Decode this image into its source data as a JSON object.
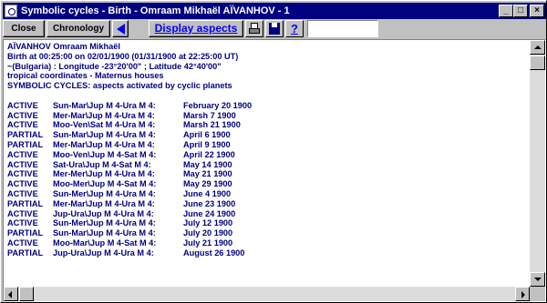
{
  "window": {
    "title": "Symbolic cycles - Birth - Omraam Mikhaël AÏVANHOV - 1",
    "controls": {
      "minimize": "_",
      "maximize": "□",
      "close": "×"
    }
  },
  "toolbar": {
    "close_label": "Close",
    "chronology_label": "Chronology",
    "display_aspects_label": "Display aspects",
    "help_label": "?",
    "search_value": ""
  },
  "colors": {
    "text": "#000080",
    "titlebar": "#000080",
    "link": "#0000ff",
    "face": "#c0c0c0"
  },
  "icons": {
    "back": "left-arrow-icon",
    "print": "printer-icon",
    "save": "floppy-disk-icon",
    "help": "help-icon"
  },
  "report": {
    "header": [
      "AÏVANHOV Omraam Mikhaël",
      "Birth at 00:25:00 on 02/01/1900 (01/31/1900 at 22:25:00 UT)",
      "~(Bulgaria) : Longitude -23°20'00\" ; Latitude 42°40'00\"",
      "tropical coordinates - Maternus houses",
      "SYMBOLIC CYCLES: aspects activated by cyclic planets"
    ],
    "rows": [
      {
        "status": "ACTIVE",
        "aspect": "Sun-Mar\\Jup M 4-Ura M 4:",
        "date": "February 20 1900"
      },
      {
        "status": "ACTIVE",
        "aspect": "Mer-Mar\\Jup M 4-Ura M 4:",
        "date": "Marsh 7 1900"
      },
      {
        "status": "ACTIVE",
        "aspect": "Moo-Ven\\Sat M 4-Ura M 4:",
        "date": "Marsh 21 1900"
      },
      {
        "status": "PARTIAL",
        "aspect": "Sun-Mar\\Jup M 4-Ura M 4:",
        "date": "April 6 1900"
      },
      {
        "status": "PARTIAL",
        "aspect": "Mer-Mar\\Jup M 4-Ura M 4:",
        "date": "April 9 1900"
      },
      {
        "status": "ACTIVE",
        "aspect": "Moo-Ven\\Jup M 4-Sat M 4:",
        "date": "April 22 1900"
      },
      {
        "status": "ACTIVE",
        "aspect": "Sat-Ura\\Jup M 4-Sat M 4:",
        "date": "May 14 1900"
      },
      {
        "status": "ACTIVE",
        "aspect": "Mer-Mer\\Jup M 4-Ura M 4:",
        "date": "May 21 1900"
      },
      {
        "status": "ACTIVE",
        "aspect": "Moo-Mer\\Jup M 4-Sat M 4:",
        "date": "May 29 1900"
      },
      {
        "status": "ACTIVE",
        "aspect": "Sun-Mer\\Jup M 4-Ura M 4:",
        "date": "June 4 1900"
      },
      {
        "status": "PARTIAL",
        "aspect": "Mer-Mar\\Jup M 4-Ura M 4:",
        "date": "June 23 1900"
      },
      {
        "status": "ACTIVE",
        "aspect": "Jup-Ura\\Jup M 4-Ura M 4:",
        "date": "June 24 1900"
      },
      {
        "status": "ACTIVE",
        "aspect": "Sun-Mer\\Jup M 4-Ura M 4:",
        "date": "July 12 1900"
      },
      {
        "status": "PARTIAL",
        "aspect": "Sun-Mar\\Jup M 4-Ura M 4:",
        "date": "July 20 1900"
      },
      {
        "status": "ACTIVE",
        "aspect": "Moo-Mar\\Jup M 4-Sat M 4:",
        "date": "July 21 1900"
      },
      {
        "status": "PARTIAL",
        "aspect": "Jup-Ura\\Jup M 4-Ura M 4:",
        "date": "August 26 1900"
      }
    ]
  }
}
